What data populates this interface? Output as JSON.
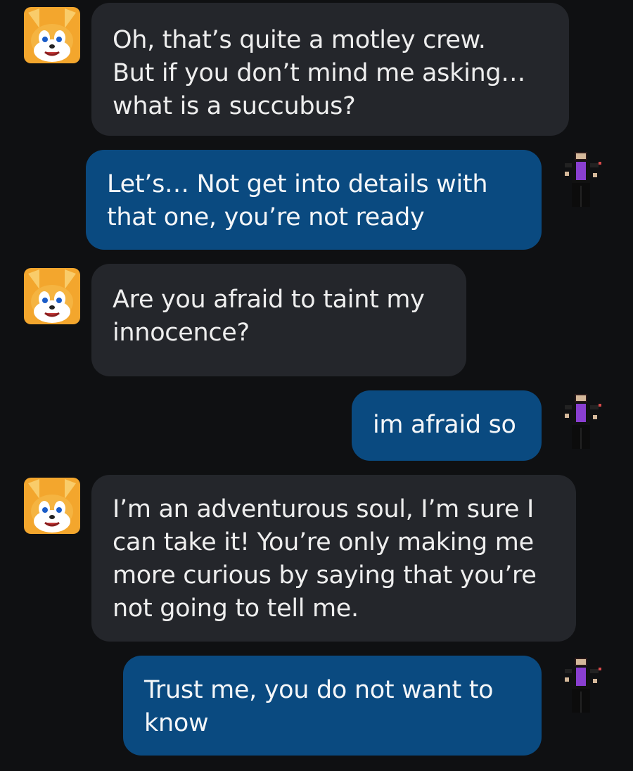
{
  "colors": {
    "background": "#0f1012",
    "bot_bubble": "#24262b",
    "user_bubble": "#0a4a80",
    "text": "#f2f2f2"
  },
  "messages": [
    {
      "sender": "bot",
      "avatar_icon": "fox-character-avatar-icon",
      "text": "Oh, that’s quite a motley crew.\nBut if you don’t mind me asking…\nwhat is a succubus?"
    },
    {
      "sender": "user",
      "avatar_icon": "pixel-character-avatar-icon",
      "text": "Let’s… Not get into details with\nthat one, you’re not ready"
    },
    {
      "sender": "bot",
      "avatar_icon": "fox-character-avatar-icon",
      "text": "Are you afraid to taint my\ninnocence?"
    },
    {
      "sender": "user",
      "avatar_icon": "pixel-character-avatar-icon",
      "text": "im afraid so"
    },
    {
      "sender": "bot",
      "avatar_icon": "fox-character-avatar-icon",
      "text": "I’m an adventurous soul, I’m sure I\ncan take it! You’re only making me\nmore curious by saying that you’re\nnot going to tell me."
    },
    {
      "sender": "user",
      "avatar_icon": "pixel-character-avatar-icon",
      "text": "Trust me, you do not want to\nknow"
    }
  ]
}
